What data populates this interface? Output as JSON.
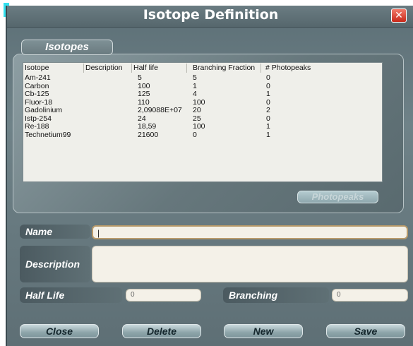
{
  "window": {
    "title": "Isotope Definition",
    "close_glyph": "✕"
  },
  "isotopes": {
    "group_label": "Isotopes",
    "columns": [
      "Isotope",
      "Description",
      "Half life",
      "Branching Fraction",
      "# Photopeaks"
    ],
    "rows": [
      [
        "Am-241",
        "",
        "5",
        "5",
        "0"
      ],
      [
        "Carbon",
        "",
        "100",
        "1",
        "0"
      ],
      [
        "Cb-125",
        "",
        "125",
        "4",
        "1"
      ],
      [
        "Fluor-18",
        "",
        "110",
        "100",
        "0"
      ],
      [
        "Gadolinium",
        "",
        "2,09088E+07",
        "20",
        "2"
      ],
      [
        "Istp-254",
        "",
        "24",
        "25",
        "0"
      ],
      [
        "Re-188",
        "",
        "18,59",
        "100",
        "1"
      ],
      [
        "Technetium99",
        "",
        "21600",
        "0",
        "1"
      ]
    ],
    "photopeaks_label": "Photopeaks"
  },
  "form": {
    "name_label": "Name",
    "name_value": "|",
    "description_label": "Description",
    "description_value": "",
    "halflife_label": "Half Life",
    "halflife_value": "0",
    "branching_label": "Branching",
    "branching_value": "0"
  },
  "buttons": {
    "close": "Close",
    "delete": "Delete",
    "new": "New",
    "save": "Save"
  },
  "colors": {
    "panel": "#6f8288",
    "close_button": "#d8321f",
    "input_bg": "#f4f1e8",
    "accent": "#33e0ee"
  }
}
